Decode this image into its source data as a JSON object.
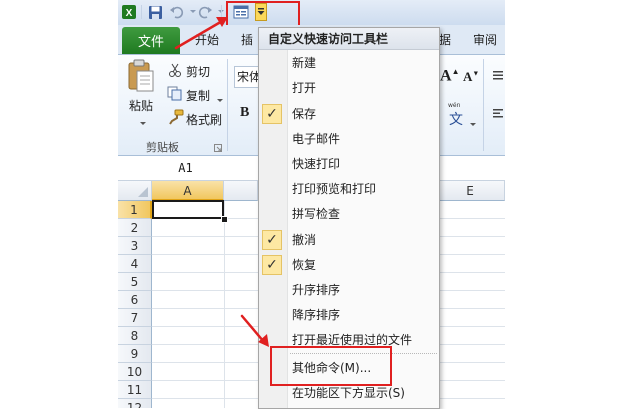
{
  "quick_access": {
    "app_icon": "excel-icon",
    "items": [
      {
        "name": "save-icon"
      },
      {
        "name": "undo-icon"
      },
      {
        "name": "redo-icon"
      },
      {
        "name": "form-icon"
      },
      {
        "name": "customize-dropdown-icon"
      }
    ]
  },
  "ribbon": {
    "file_tab": "文件",
    "tabs": [
      "开始",
      "插",
      "据",
      "审阅"
    ],
    "clipboard": {
      "paste": "粘贴",
      "cut": "剪切",
      "copy": "复制",
      "format_painter": "格式刷",
      "group_label": "剪贴板"
    },
    "font": {
      "name_partial": "宋体",
      "bold": "B"
    },
    "right_controls": {
      "grow_font": "A",
      "shrink_font": "A",
      "phonetic": "文",
      "phonetic_small": "wén"
    }
  },
  "name_box": {
    "value": "A1"
  },
  "sheet": {
    "columns": [
      "A",
      "E"
    ],
    "rows": [
      "1",
      "2",
      "3",
      "4",
      "5",
      "6",
      "7",
      "8",
      "9",
      "10",
      "11",
      "12"
    ],
    "selected_cell": "A1"
  },
  "menu": {
    "title": "自定义快速访问工具栏",
    "items": [
      {
        "label": "新建",
        "checked": false
      },
      {
        "label": "打开",
        "checked": false
      },
      {
        "label": "保存",
        "checked": true
      },
      {
        "label": "电子邮件",
        "checked": false
      },
      {
        "label": "快速打印",
        "checked": false
      },
      {
        "label": "打印预览和打印",
        "checked": false
      },
      {
        "label": "拼写检查",
        "checked": false
      },
      {
        "label": "撤消",
        "checked": true
      },
      {
        "label": "恢复",
        "checked": true
      },
      {
        "label": "升序排序",
        "checked": false
      },
      {
        "label": "降序排序",
        "checked": false
      },
      {
        "label": "打开最近使用过的文件",
        "checked": false
      }
    ],
    "more_commands": "其他命令(M)...",
    "show_below": "在功能区下方显示(S)",
    "check_glyph": "✓"
  },
  "colors": {
    "annotation_red": "#e02020",
    "file_tab_green": "#217a23",
    "check_bg": "#fde8a3"
  }
}
